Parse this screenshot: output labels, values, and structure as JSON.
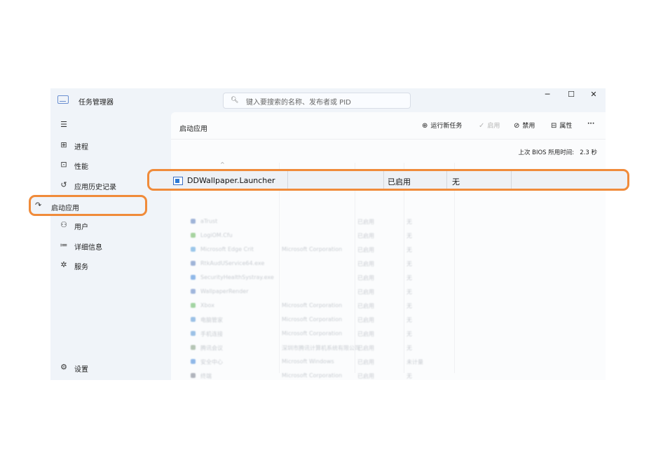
{
  "window": {
    "title": "任务管理器",
    "search_placeholder": "键入要搜索的名称、发布者或 PID",
    "controls": {
      "minimize": "─",
      "maximize": "☐",
      "close": "✕"
    }
  },
  "sidebar": {
    "menu_glyph": "☰",
    "items": [
      {
        "label": "进程",
        "icon": "⊞"
      },
      {
        "label": "性能",
        "icon": "⊡"
      },
      {
        "label": "应用历史记录",
        "icon": "↺"
      },
      {
        "label": "启动应用",
        "icon": "↷"
      },
      {
        "label": "用户",
        "icon": "⚇"
      },
      {
        "label": "详细信息",
        "icon": "≔"
      },
      {
        "label": "服务",
        "icon": "✲"
      }
    ],
    "settings": {
      "label": "设置",
      "icon": "⚙"
    }
  },
  "content": {
    "title": "启动应用",
    "toolbar": {
      "run_task": {
        "label": "运行新任务",
        "icon": "⊕"
      },
      "enable": {
        "label": "启用",
        "icon": "✓"
      },
      "disable": {
        "label": "禁用",
        "icon": "⊘"
      },
      "properties": {
        "label": "属性",
        "icon": "⊟"
      },
      "more": "···"
    },
    "bios_label": "上次 BIOS 所用时间:",
    "bios_value": "2.3 秒",
    "sort_caret": "^"
  },
  "highlighted_row": {
    "name": "DDWallpaper.Launcher",
    "publisher": "",
    "status": "已启用",
    "impact": "无"
  },
  "rows": [
    {
      "name": "aTrust",
      "publisher": "",
      "status": "已启用",
      "impact": "无",
      "color": "#9fb4d8"
    },
    {
      "name": "LogiOM.Cfu",
      "publisher": "",
      "status": "已启用",
      "impact": "无",
      "color": "#a7d3a0"
    },
    {
      "name": "Microsoft Edge Crit",
      "publisher": "Microsoft Corporation",
      "status": "已启用",
      "impact": "无",
      "color": "#9cc7ea"
    },
    {
      "name": "RtkAudUService64.exe",
      "publisher": "",
      "status": "已启用",
      "impact": "无",
      "color": "#9fb4d8"
    },
    {
      "name": "SecurityHealthSystray.exe",
      "publisher": "",
      "status": "已启用",
      "impact": "无",
      "color": "#8fb8e8"
    },
    {
      "name": "WallpaperRender",
      "publisher": "",
      "status": "已启用",
      "impact": "无",
      "color": "#a0b6dc"
    },
    {
      "name": "Xbox",
      "publisher": "Microsoft Corporation",
      "status": "已启用",
      "impact": "无",
      "color": "#a3d4a3"
    },
    {
      "name": "电脑管家",
      "publisher": "Microsoft Corporation",
      "status": "已启用",
      "impact": "无",
      "color": "#9cc1e6"
    },
    {
      "name": "手机连接",
      "publisher": "Microsoft Corporation",
      "status": "已启用",
      "impact": "无",
      "color": "#9cc1e6"
    },
    {
      "name": "腾讯会议",
      "publisher": "深圳市腾讯计算机系统有限公司",
      "status": "已启用",
      "impact": "无",
      "color": "#b5c5b5"
    },
    {
      "name": "安全中心",
      "publisher": "Microsoft Windows",
      "status": "已启用",
      "impact": "未计量",
      "color": "#8fb8e8"
    },
    {
      "name": "终端",
      "publisher": "Microsoft Corporation",
      "status": "已启用",
      "impact": "无",
      "color": "#b0b4bc"
    }
  ]
}
